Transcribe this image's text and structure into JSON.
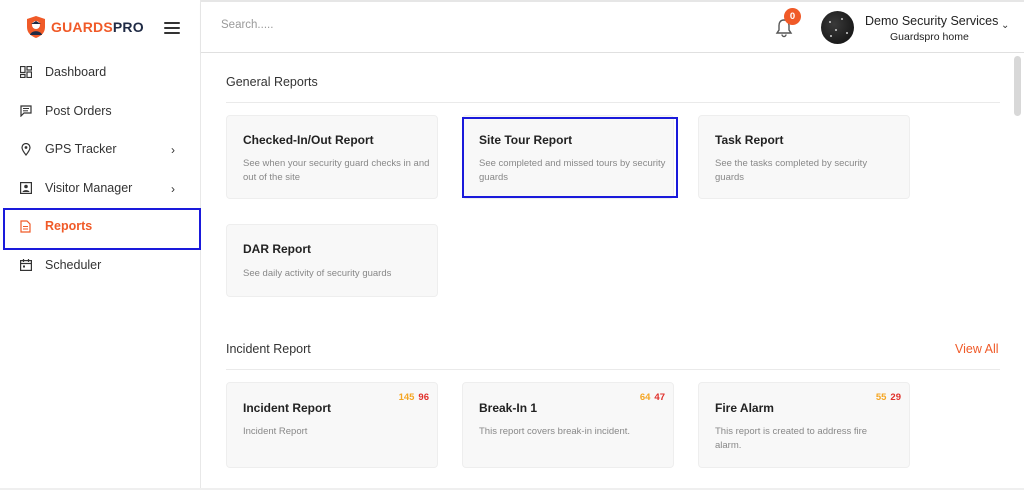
{
  "brand": {
    "part1": "GUARDS",
    "part2": "PRO",
    "accent": "#f05a28",
    "dark": "#1f2a44"
  },
  "sidebar": {
    "items": [
      {
        "label": "Dashboard",
        "icon": "dashboard-icon"
      },
      {
        "label": "Post Orders",
        "icon": "post-orders-icon"
      },
      {
        "label": "GPS Tracker",
        "icon": "location-pin-icon",
        "has_submenu": true
      },
      {
        "label": "Visitor Manager",
        "icon": "visitor-icon",
        "has_submenu": true
      },
      {
        "label": "Reports",
        "icon": "report-icon",
        "active": true
      },
      {
        "label": "Scheduler",
        "icon": "calendar-icon"
      }
    ]
  },
  "header": {
    "search_placeholder": "Search.....",
    "notification_count": "0",
    "company_name": "Demo Security Services",
    "company_sub": "Guardspro home"
  },
  "general_reports": {
    "title": "General Reports",
    "cards": [
      {
        "title": "Checked-In/Out Report",
        "desc": "See when your security guard checks in and out of the site"
      },
      {
        "title": "Site Tour Report",
        "desc": "See completed and missed tours by security guards",
        "highlighted": true
      },
      {
        "title": "Task Report",
        "desc": "See the tasks completed by security guards"
      },
      {
        "title": "DAR Report",
        "desc": "See daily activity of security guards"
      }
    ]
  },
  "incident_reports": {
    "title": "Incident Report",
    "view_all": "View All",
    "cards": [
      {
        "title": "Incident Report",
        "desc": "Incident Report",
        "count_a": "145",
        "count_b": "96"
      },
      {
        "title": "Break-In 1",
        "desc": "This report covers break-in incident.",
        "count_a": "64",
        "count_b": "47"
      },
      {
        "title": "Fire Alarm",
        "desc": "This report is created to address fire alarm.",
        "count_a": "55",
        "count_b": "29"
      }
    ]
  }
}
